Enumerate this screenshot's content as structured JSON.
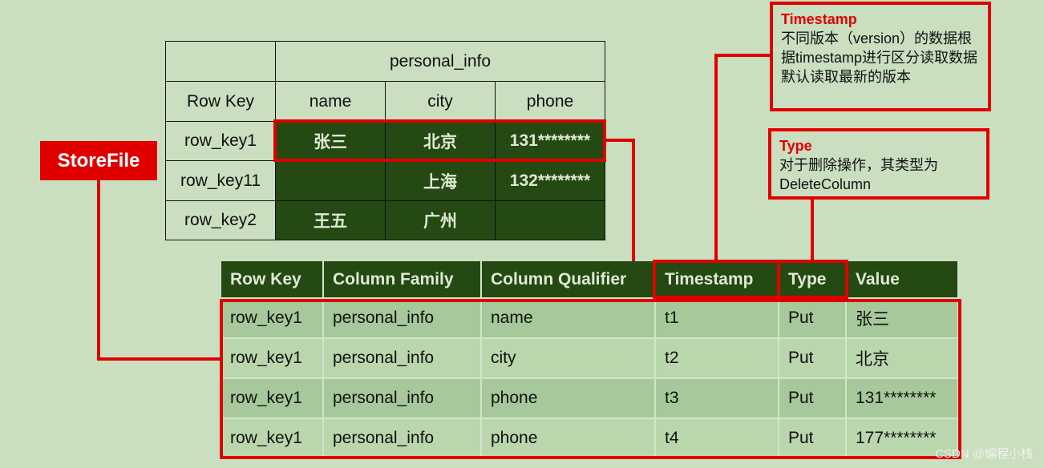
{
  "colors": {
    "background": "#c9dfc0",
    "dark_green": "#244912",
    "highlight_red": "#e00000"
  },
  "logical_table": {
    "family": "personal_info",
    "headers": [
      "Row Key",
      "name",
      "city",
      "phone"
    ],
    "rows": [
      [
        "row_key1",
        "张三",
        "北京",
        "131********"
      ],
      [
        "row_key11",
        "",
        "上海",
        "132********"
      ],
      [
        "row_key2",
        "王五",
        "广州",
        ""
      ]
    ]
  },
  "storefile_label": "StoreFile",
  "storefile_table": {
    "headers": [
      "Row Key",
      "Column Family",
      "Column Qualifier",
      "Timestamp",
      "Type",
      "Value"
    ],
    "rows": [
      [
        "row_key1",
        "personal_info",
        "name",
        "t1",
        "Put",
        "张三"
      ],
      [
        "row_key1",
        "personal_info",
        "city",
        "t2",
        "Put",
        "北京"
      ],
      [
        "row_key1",
        "personal_info",
        "phone",
        "t3",
        "Put",
        "131********"
      ],
      [
        "row_key1",
        "personal_info",
        "phone",
        "t4",
        "Put",
        "177********"
      ]
    ]
  },
  "callouts": {
    "timestamp": {
      "title": "Timestamp",
      "text": "不同版本（version）的数据根据timestamp进行区分读取数据默认读取最新的版本"
    },
    "type": {
      "title": "Type",
      "text": "对于删除操作，其类型为DeleteColumn"
    }
  },
  "watermark": "CSDN @编程小栈"
}
